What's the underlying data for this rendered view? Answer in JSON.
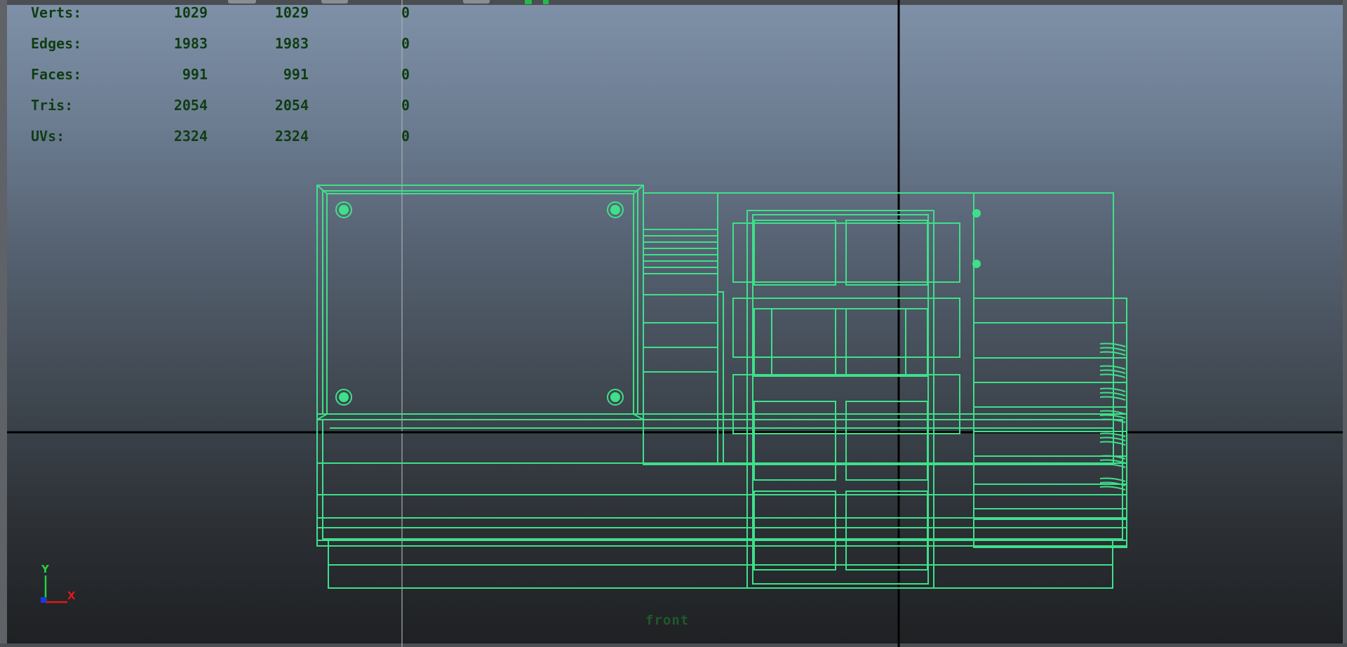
{
  "hud": {
    "rows": [
      {
        "label": "Verts:",
        "object": "1029",
        "selected": "1029",
        "components": "0"
      },
      {
        "label": "Edges:",
        "object": "1983",
        "selected": "1983",
        "components": "0"
      },
      {
        "label": "Faces:",
        "object": "991",
        "selected": "991",
        "components": "0"
      },
      {
        "label": "Tris:",
        "object": "2054",
        "selected": "2054",
        "components": "0"
      },
      {
        "label": "UVs:",
        "object": "2324",
        "selected": "2324",
        "components": "0"
      }
    ]
  },
  "camera": {
    "name": "front"
  },
  "axis": {
    "y_label": "Y",
    "x_label": "X"
  },
  "colors": {
    "wireframe": "#3ee08a",
    "hud_text": "#0f3d12",
    "camera_label": "#1f5a2a",
    "grid_axis": "#000000",
    "axis_y": "#22d23c",
    "axis_x": "#e01818",
    "axis_z": "#1a38e0"
  }
}
